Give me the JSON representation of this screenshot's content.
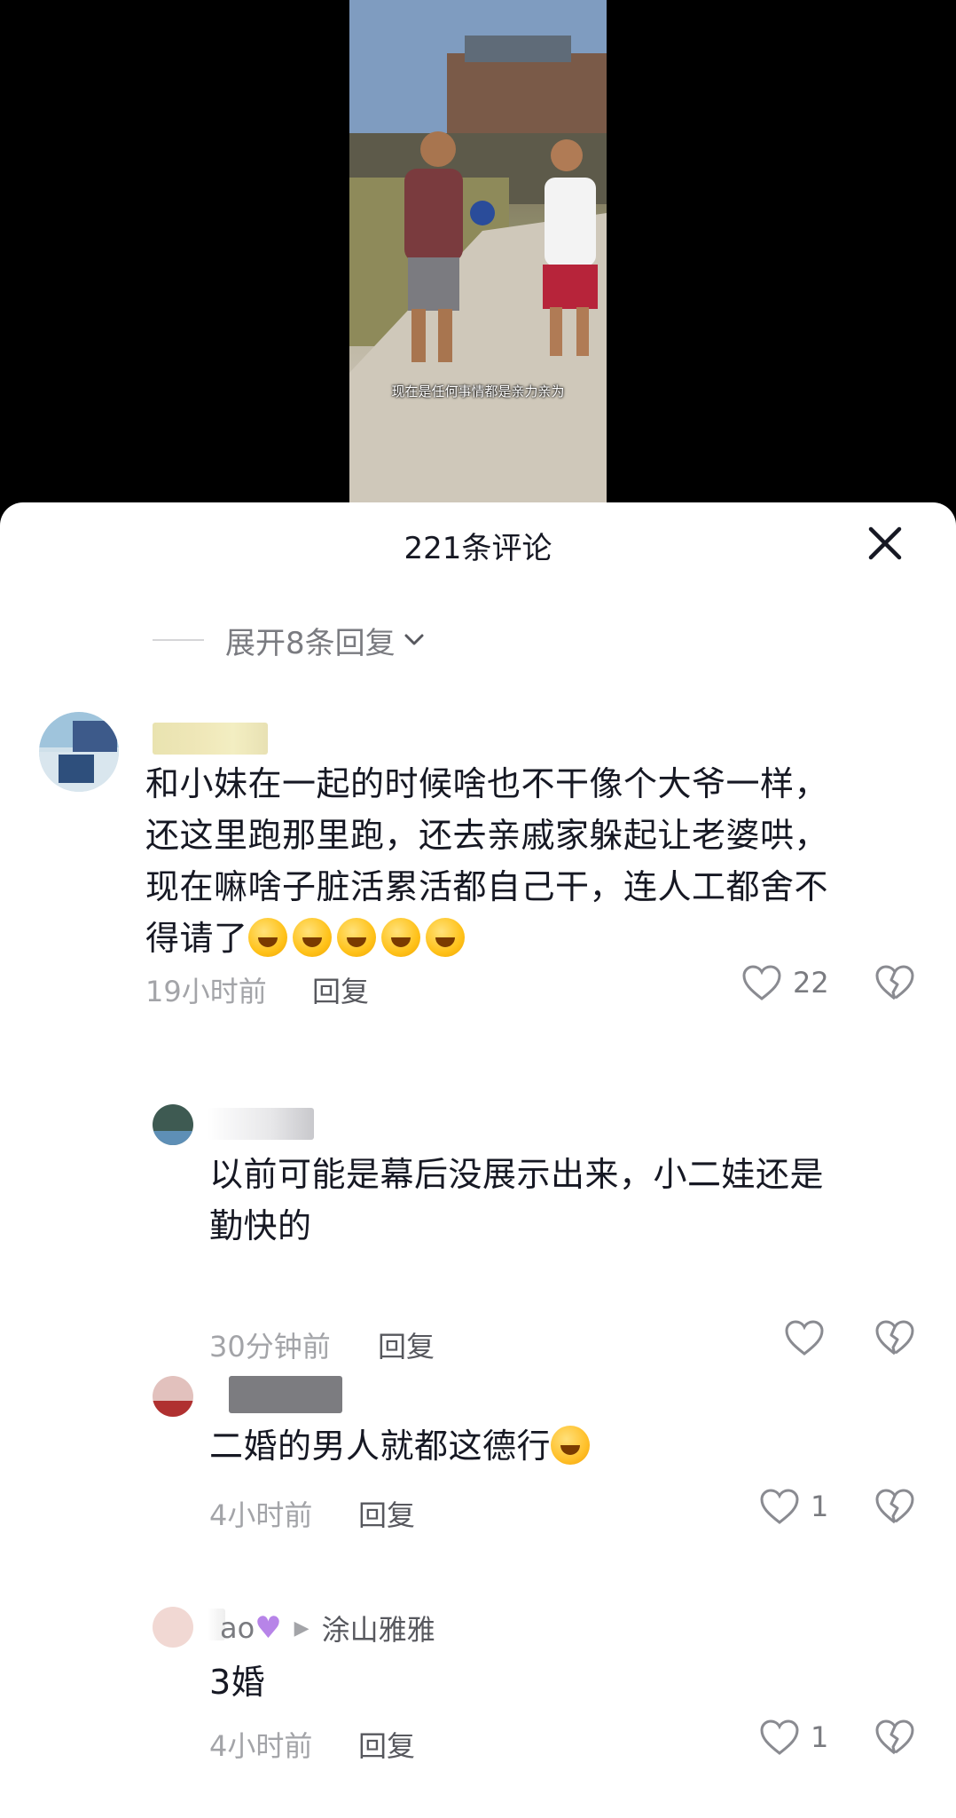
{
  "video": {
    "subtitle": "现在是任何事情都是亲力亲为"
  },
  "sheet": {
    "title": "221条评论",
    "close_icon": "close-icon"
  },
  "expand": {
    "label": "展开8条回复"
  },
  "comments": [
    {
      "text_lines": [
        "和小妹在一起的时候啥也不干像个大爷一样，",
        "还这里跑那里跑，还去亲戚家躲起让老婆哄，",
        "现在嘛啥子脏活累活都自己干，连人工都舍不",
        "得请了"
      ],
      "emoji_count": 5,
      "time": "19小时前",
      "reply_label": "回复",
      "likes": "22"
    },
    {
      "text_lines": [
        "以前可能是幕后没展示出来，小二娃还是",
        "勤快的"
      ],
      "time": "30分钟前",
      "reply_label": "回复",
      "likes": ""
    },
    {
      "text": "二婚的男人就都这德行",
      "time": "4小时前",
      "reply_label": "回复",
      "likes": "1"
    },
    {
      "name_partial": "ao",
      "reply_to": "涂山雅雅",
      "text": "3婚",
      "time": "4小时前",
      "reply_label": "回复",
      "likes": "1"
    }
  ]
}
